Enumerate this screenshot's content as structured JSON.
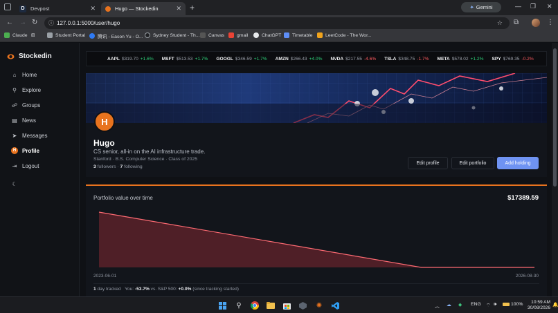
{
  "browser": {
    "tabs": [
      {
        "title": "Devpost",
        "favicon": "D"
      },
      {
        "title": "Hugo — Stockedin"
      }
    ],
    "gemini_label": "Gemini",
    "url": "127.0.0.1:5000/user/hugo",
    "bookmarks": [
      "Claude",
      "Student Portal",
      "腾讯 - Eason Yu - O...",
      "Sydney Student - Th...",
      "Canvas",
      "gmail",
      "ChatGPT",
      "Timetable",
      "LeetCode - The Wor..."
    ]
  },
  "sidebar": {
    "brand": "Stockedin",
    "items": [
      {
        "label": "Home",
        "icon": "home-icon",
        "glyph": "⌂"
      },
      {
        "label": "Explore",
        "icon": "search-icon",
        "glyph": "⚲"
      },
      {
        "label": "Groups",
        "icon": "users-icon",
        "glyph": "☍"
      },
      {
        "label": "News",
        "icon": "news-icon",
        "glyph": "▤"
      },
      {
        "label": "Messages",
        "icon": "send-icon",
        "glyph": "➤"
      },
      {
        "label": "Profile",
        "icon": "profile-avatar-icon",
        "glyph": "H"
      },
      {
        "label": "Logout",
        "icon": "logout-icon",
        "glyph": "⇥"
      }
    ],
    "theme_toggle_glyph": "☾"
  },
  "ticker": [
    {
      "symbol": "AAPL",
      "price": "$319.70",
      "change": "+1.6%",
      "dir": "up"
    },
    {
      "symbol": "MSFT",
      "price": "$513.53",
      "change": "+1.7%",
      "dir": "up"
    },
    {
      "symbol": "GOOGL",
      "price": "$346.59",
      "change": "+1.7%",
      "dir": "up"
    },
    {
      "symbol": "AMZN",
      "price": "$266.43",
      "change": "+4.0%",
      "dir": "up"
    },
    {
      "symbol": "NVDA",
      "price": "$217.55",
      "change": "-4.6%",
      "dir": "down"
    },
    {
      "symbol": "TSLA",
      "price": "$348.75",
      "change": "-1.7%",
      "dir": "down"
    },
    {
      "symbol": "META",
      "price": "$578.02",
      "change": "+1.2%",
      "dir": "up"
    },
    {
      "symbol": "SPY",
      "price": "$769.35",
      "change": "-0.2%",
      "dir": "down"
    }
  ],
  "profile": {
    "initial": "H",
    "name": "Hugo",
    "bio": "CS senior, all-in on the AI infrastructure trade.",
    "meta": "Stanford · B.S. Computer Science · Class of 2025",
    "followers": "3",
    "followers_label": "followers ·",
    "following": "7",
    "following_label": "following",
    "buttons": {
      "edit_profile": "Edit profile",
      "edit_portfolio": "Edit portfolio",
      "add_holding": "Add holding"
    }
  },
  "portfolio": {
    "title": "Portfolio value over time",
    "total": "$17389.59",
    "tracked_days": "1",
    "tracked_label": "day tracked",
    "you_label": "You:",
    "you_value": "-53.7%",
    "vs_label": "vs. S&P 500:",
    "sp_value": "+0.0%",
    "since_label": "(since tracking started)"
  },
  "chart_data": {
    "type": "area",
    "x": [
      "2023-06-01",
      "2026-08-30"
    ],
    "tick_labels": [
      "2023-06-01",
      "2026-08-30"
    ],
    "series": [
      {
        "values": [
          1.0,
          0.0,
          0.0
        ],
        "points_x": [
          0.0,
          0.74,
          1.0
        ]
      }
    ],
    "line_color": "#ff6b73",
    "fill_color": "#5a2129"
  },
  "taskbar": {
    "lang": "ENG",
    "battery": "100%",
    "time": "10:59 AM",
    "date": "30/08/2026"
  }
}
